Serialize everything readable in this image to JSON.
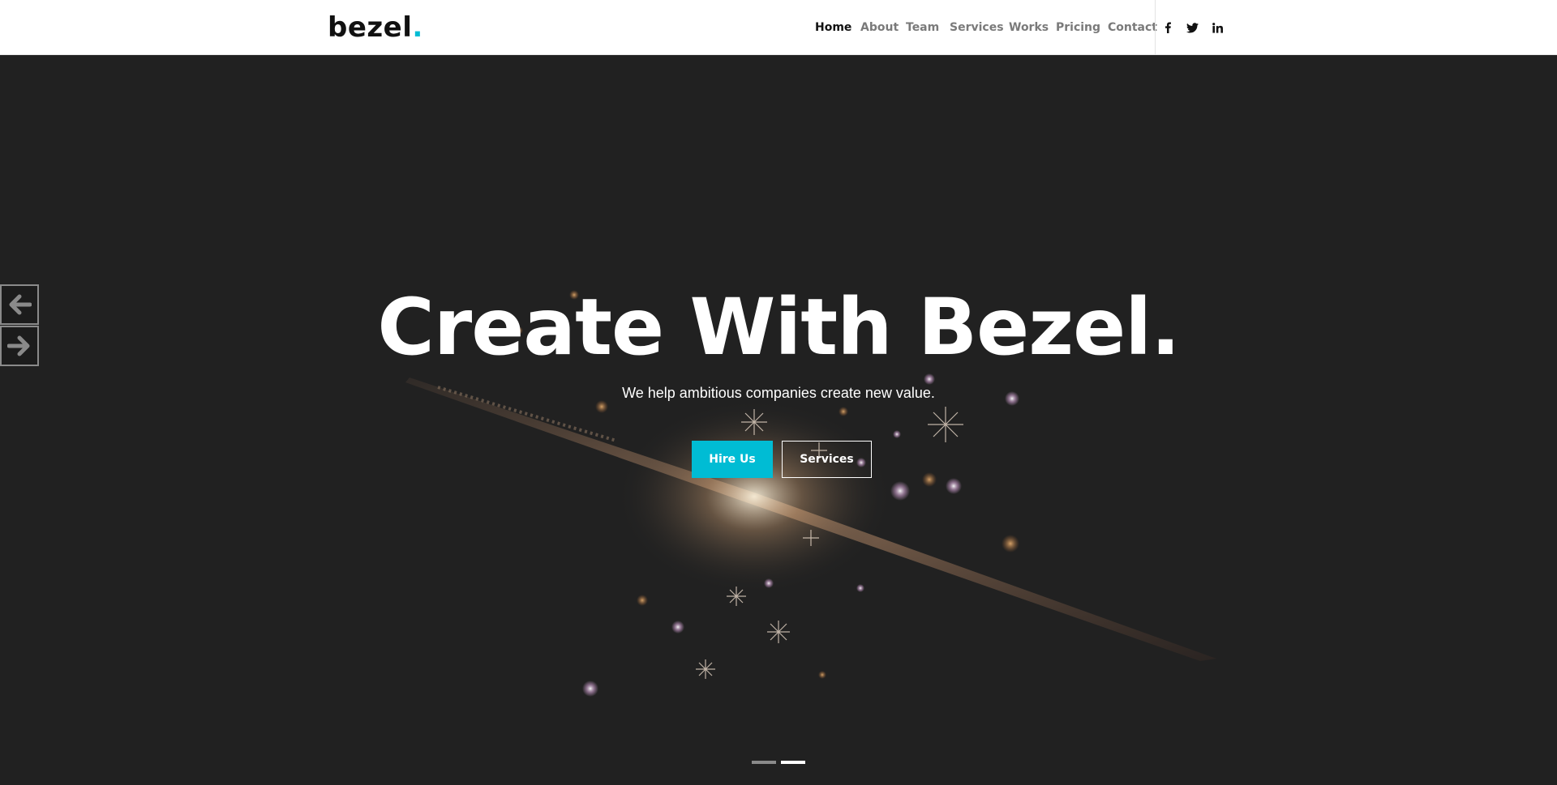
{
  "brand": {
    "name": "bezel",
    "dot": ".",
    "accent_color": "#00bcd4"
  },
  "nav": {
    "items": [
      {
        "label": "Home",
        "active": true
      },
      {
        "label": "About",
        "active": false
      },
      {
        "label": "Team",
        "active": false
      },
      {
        "label": "Services",
        "active": false
      },
      {
        "label": "Works",
        "active": false
      },
      {
        "label": "Pricing",
        "active": false
      },
      {
        "label": "Contact",
        "active": false
      }
    ],
    "social": [
      {
        "icon": "facebook-icon"
      },
      {
        "icon": "twitter-icon"
      },
      {
        "icon": "linkedin-icon"
      }
    ]
  },
  "hero": {
    "title": "Create With Bezel.",
    "subtitle": "We help ambitious companies create new value.",
    "primary_button": "Hire Us",
    "secondary_button": "Services",
    "slider": {
      "prev_icon": "arrow-left-icon",
      "next_icon": "arrow-right-icon",
      "slide_count": 2,
      "active_slide": 2
    }
  }
}
